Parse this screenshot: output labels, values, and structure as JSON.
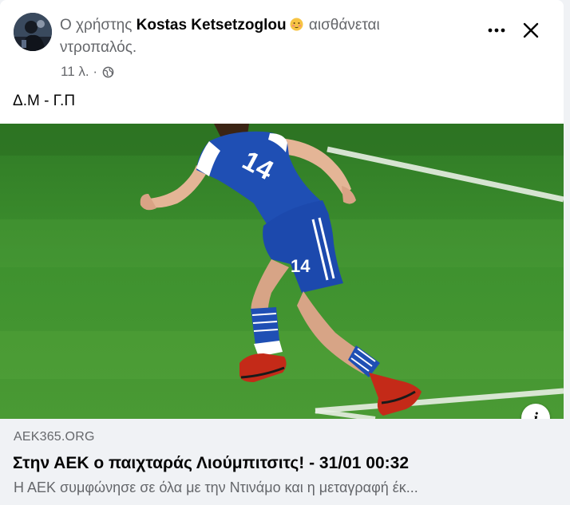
{
  "post": {
    "headline_prefix": "Ο χρήστης",
    "author_name": "Kostas Ketsetzoglou",
    "feeling_text": "αισθάνεται ντροπαλός.",
    "feeling_icon": "shy-face-emoji-icon",
    "timestamp": "11 λ. ·",
    "privacy_icon": "globe-icon",
    "text": "Δ.Μ - Γ.Π"
  },
  "actions": {
    "more_icon": "more-dots-icon",
    "close_icon": "close-icon"
  },
  "link_preview": {
    "domain": "AEK365.ORG",
    "title": "Στην ΑΕΚ ο παιχταράς Λιούμπιτσιτς! - 31/01 00:32",
    "description": "Η ΑΕΚ συμφώνησε σε όλα με την Ντινάμο και η μεταγραφή έκ...",
    "info_label": "i",
    "jersey_number": "14"
  },
  "colors": {
    "text_primary": "#050505",
    "text_secondary": "#65676b",
    "link_box_bg": "#f0f2f5",
    "pitch_green": "#3f8f2f",
    "jersey_blue": "#1f4fb4"
  }
}
